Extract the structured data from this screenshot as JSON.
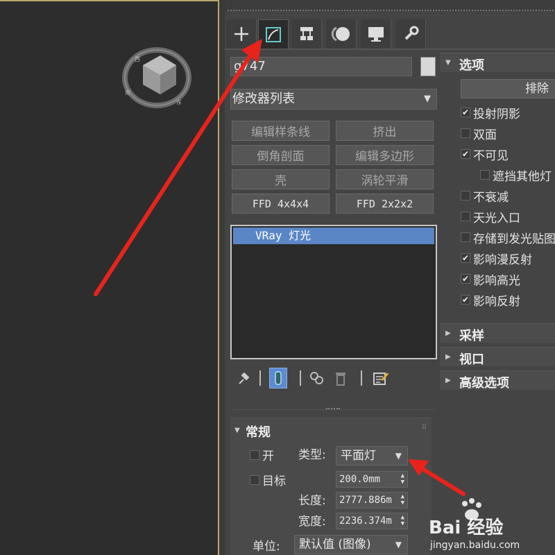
{
  "command_panel": {
    "tabs": [
      {
        "name": "create",
        "icon": "plus-icon"
      },
      {
        "name": "modify",
        "icon": "modify-icon",
        "active": true
      },
      {
        "name": "hierarchy",
        "icon": "hierarchy-icon"
      },
      {
        "name": "motion",
        "icon": "motion-icon"
      },
      {
        "name": "display",
        "icon": "monitor-icon"
      },
      {
        "name": "utilities",
        "icon": "wrench-icon"
      }
    ],
    "object_name": "g747",
    "modifier_list": "修改器列表",
    "modifier_buttons": [
      "编辑样条线",
      "挤出",
      "倒角剖面",
      "编辑多边形",
      "壳",
      "涡轮平滑",
      "FFD 4x4x4",
      "FFD 2x2x2"
    ],
    "stack_item": "VRay 灯光"
  },
  "general_rollout": {
    "title": "常规",
    "on_label": "开",
    "type_label": "类型:",
    "type_value": "平面灯",
    "target_label": "目标",
    "target_value": "200.0mm",
    "length_label": "长度:",
    "length_value": "2777.886m",
    "width_label": "宽度:",
    "width_value": "2236.374m",
    "units_label": "单位:",
    "units_value": "默认值 (图像)"
  },
  "options_rollout": {
    "title": "选项",
    "exclude_button": "排除",
    "options": [
      {
        "label": "投射阴影",
        "checked": true
      },
      {
        "label": "双面",
        "checked": false
      },
      {
        "label": "不可见",
        "checked": true
      },
      {
        "label": "遮挡其他灯",
        "checked": false,
        "indent": true
      },
      {
        "label": "不衰减",
        "checked": false
      },
      {
        "label": "天光入口",
        "checked": false
      },
      {
        "label": "存储到发光贴图",
        "checked": false
      },
      {
        "label": "影响漫反射",
        "checked": true
      },
      {
        "label": "影响高光",
        "checked": true
      },
      {
        "label": "影响反射",
        "checked": true
      }
    ],
    "collapsed_sections": [
      "采样",
      "视口",
      "高级选项"
    ]
  },
  "watermark": {
    "brand": "Bai 经验",
    "url": "jingyan.baidu.com"
  },
  "colors": {
    "annotation_arrow": "#e8231c",
    "selection": "#5a86c5",
    "viewport_border": "#b8a56a"
  }
}
